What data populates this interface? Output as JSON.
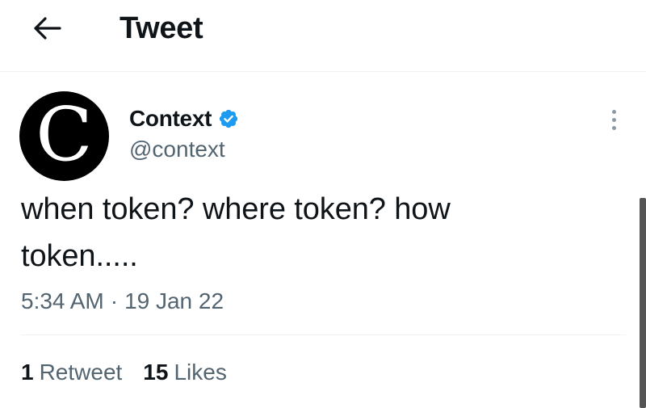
{
  "header": {
    "title": "Tweet",
    "back_icon": "arrow-left-icon"
  },
  "tweet": {
    "avatar_letter": "C",
    "display_name": "Context",
    "verified_icon": "verified-badge-icon",
    "handle": "@context",
    "text_line1": "when token? where token? how",
    "text_line2": "token.....",
    "time": "5:34 AM",
    "separator": "·",
    "date": "19 Jan 22",
    "retweets_count": "1",
    "retweets_label": "Retweet",
    "likes_count": "15",
    "likes_label": "Likes",
    "more_icon": "more-vertical-icon"
  },
  "colors": {
    "text_primary": "#0f1419",
    "text_secondary": "#536471",
    "verified_blue": "#1d9bf0",
    "divider": "#eff3f4",
    "avatar_bg": "#000000"
  }
}
